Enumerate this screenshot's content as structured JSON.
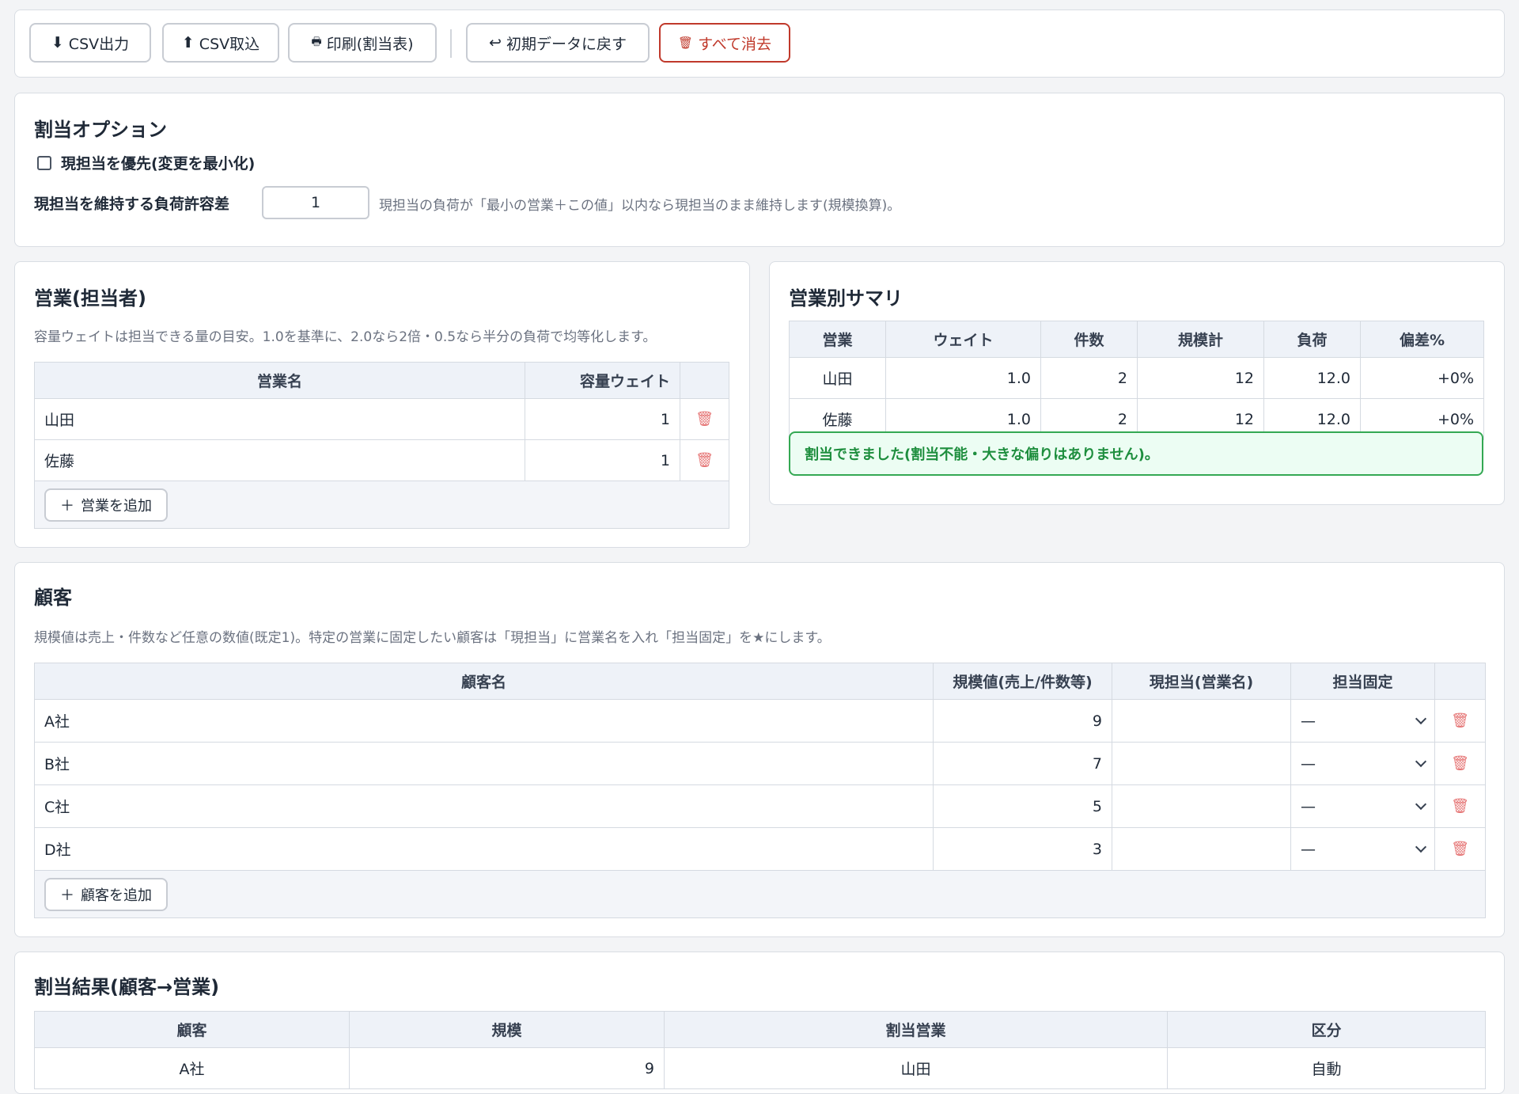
{
  "toolbar": {
    "csv_export": "CSV出力",
    "csv_import": "CSV取込",
    "print": "印刷(割当表)",
    "reset": "初期データに戻す",
    "clear_all": "すべて消去"
  },
  "options": {
    "title": "割当オプション",
    "prefer_current_label": "現担当を優先(変更を最小化)",
    "prefer_current_checked": false,
    "tolerance_label": "現担当を維持する負荷許容差",
    "tolerance_value": "1",
    "tolerance_hint": "現担当の負荷が「最小の営業＋この値」以内なら現担当のまま維持します(規模換算)。"
  },
  "sales": {
    "title": "営業(担当者)",
    "hint": "容量ウェイトは担当できる量の目安。1.0を基準に、2.0なら2倍・0.5なら半分の負荷で均等化します。",
    "columns": [
      "営業名",
      "容量ウェイト"
    ],
    "rows": [
      {
        "name": "山田",
        "weight": "1"
      },
      {
        "name": "佐藤",
        "weight": "1"
      }
    ],
    "add_label": "営業を追加"
  },
  "summary": {
    "title": "営業別サマリ",
    "columns": [
      "営業",
      "ウェイト",
      "件数",
      "規模計",
      "負荷",
      "偏差%"
    ],
    "rows": [
      [
        "山田",
        "1.0",
        "2",
        "12",
        "12.0",
        "+0%"
      ],
      [
        "佐藤",
        "1.0",
        "2",
        "12",
        "12.0",
        "+0%"
      ]
    ],
    "status": "割当できました(割当不能・大きな偏りはありません)。"
  },
  "customers": {
    "title": "顧客",
    "hint": "規模値は売上・件数など任意の数値(既定1)。特定の営業に固定したい顧客は「現担当」に営業名を入れ「担当固定」を★にします。",
    "columns": [
      "顧客名",
      "規模値(売上/件数等)",
      "現担当(営業名)",
      "担当固定"
    ],
    "rows": [
      {
        "name": "A社",
        "size": "9",
        "current": "",
        "fixed": "—"
      },
      {
        "name": "B社",
        "size": "7",
        "current": "",
        "fixed": "—"
      },
      {
        "name": "C社",
        "size": "5",
        "current": "",
        "fixed": "—"
      },
      {
        "name": "D社",
        "size": "3",
        "current": "",
        "fixed": "—"
      }
    ],
    "add_label": "顧客を追加"
  },
  "results": {
    "title": "割当結果(顧客→営業)",
    "columns": [
      "顧客",
      "規模",
      "割当営業",
      "区分"
    ],
    "rows": [
      [
        "A社",
        "9",
        "山田",
        "自動"
      ]
    ]
  },
  "colors": {
    "danger": "#c0392b",
    "success_bg": "#ecfdf3",
    "success_border": "#34a853",
    "success_text": "#1e8e3e",
    "header_bg": "#eef2f8"
  }
}
